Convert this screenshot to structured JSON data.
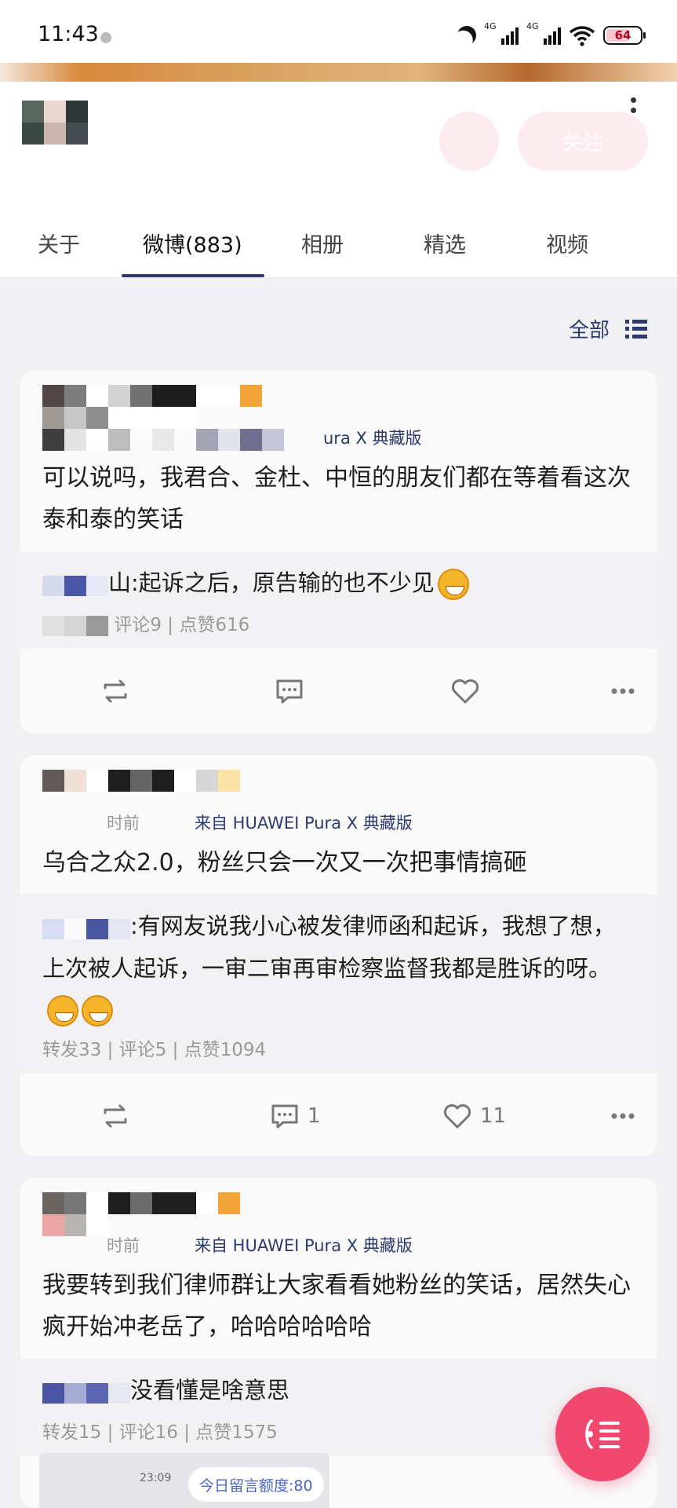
{
  "status_bar": {
    "time": "11:43",
    "signal_1": "4G",
    "signal_2": "4G",
    "battery": "64"
  },
  "profile": {
    "follow_label": "关注"
  },
  "tabs": [
    {
      "label": "关于",
      "active": false
    },
    {
      "label": "微博(883)",
      "active": true
    },
    {
      "label": "相册",
      "active": false
    },
    {
      "label": "精选",
      "active": false
    },
    {
      "label": "视频",
      "active": false
    }
  ],
  "filter": {
    "label": "全部",
    "icon": "list-view-icon"
  },
  "posts": [
    {
      "meta_source": "ura X 典藏版",
      "content": "可以说吗，我君合、金杜、中恒的朋友们都在等着看这次泰和泰的笑话",
      "quote_text": "山:起诉之后，原告输的也不少见",
      "quote_stats": "评论9 | 点赞616",
      "actions": {
        "repost": "",
        "comment": "",
        "like": ""
      }
    },
    {
      "meta_time": "时前",
      "meta_source": "来自 HUAWEI Pura X 典藏版",
      "content": "乌合之众2.0，粉丝只会一次又一次把事情搞砸",
      "quote_text": ":有网友说我小心被发律师函和起诉，我想了想，上次被人起诉，一审二审再审检察监督我都是胜诉的呀。",
      "quote_stats": "转发33 | 评论5 | 点赞1094",
      "actions": {
        "repost": "",
        "comment": "1",
        "like": "11"
      }
    },
    {
      "meta_time": "时前",
      "meta_source": "来自 HUAWEI Pura X 典藏版",
      "content": "我要转到我们律师群让大家看看她粉丝的笑话，居然失心疯开始冲老岳了，哈哈哈哈哈哈",
      "quote_text": "没看懂是啥意思",
      "quote_stats": "转发15 | 评论16 | 点赞1575"
    }
  ],
  "bottom": {
    "mini_time": "23:09",
    "toast": "今日留言额度:80"
  },
  "colors": {
    "accent_navy": "#2c3a6e",
    "fab_pink": "#f0486f",
    "follow_pink": "#fcecef"
  }
}
